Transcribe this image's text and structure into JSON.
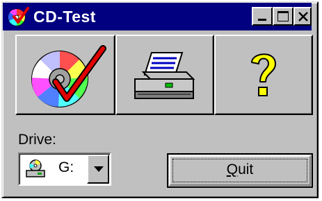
{
  "window": {
    "title": "CD-Test",
    "icon": "cd-check-icon",
    "controls": {
      "minimize": "minimize-icon",
      "maximize": "maximize-icon",
      "close": "close-icon"
    }
  },
  "toolbar": {
    "buttons": [
      {
        "icon": "cd-check-icon"
      },
      {
        "icon": "printer-icon"
      },
      {
        "icon": "help-question-icon"
      }
    ]
  },
  "drive": {
    "label": "Drive:",
    "selected": "G:",
    "icon": "cd-drive-icon"
  },
  "quit": {
    "mnemonic": "Q",
    "rest": "uit"
  },
  "colors": {
    "titlebar": "#000080",
    "face": "#c0c0c0",
    "check": "#e00000",
    "help": "#ffff00"
  }
}
